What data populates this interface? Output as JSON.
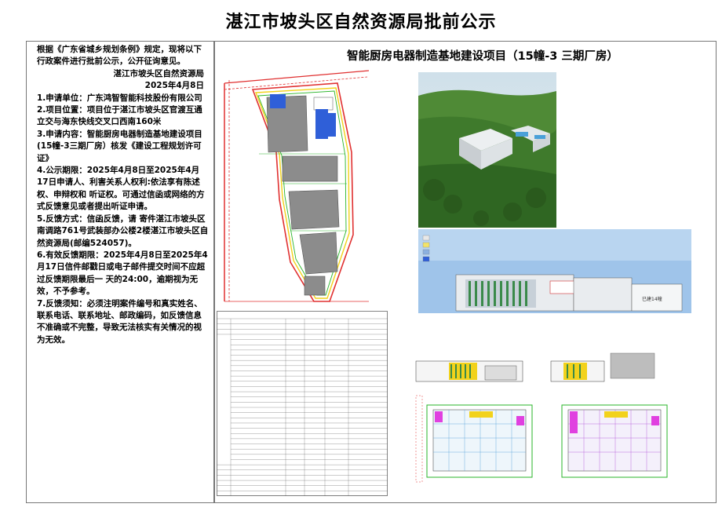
{
  "notice": {
    "title": "湛江市坡头区自然资源局批前公示",
    "intro": "根据《广东省城乡规划条例》规定，现将以下行政案件进行批前公示，公开征询意见。",
    "issuer": "湛江市坡头区自然资源局",
    "date": "2025年4月8日",
    "items": [
      "1.申请单位：广东鸿智智能科技股份有限公司",
      "2.项目位置：项目位于湛江市坡头区官渡互通立交与海东快线交叉口西南160米",
      "3.申请内容：智能厨房电器制造基地建设项目(15幢-3三期厂房）核发《建设工程规划许可证》",
      "4.公示期限：2025年4月8日至2025年4月17日申请人、利害关系人权利:依法享有陈述权、申辩权和 听证权。可通过信函或网络的方式反馈意见或者提出听证申请。",
      "5.反馈方式：信函反馈，请 寄件湛江市坡头区南调路761号武装部办公楼2楼湛江市坡头区自然资源局(邮编524057)。",
      "6.有效反馈期限：2025年4月8日至2025年4月17日信件邮戳日或电子邮件提交时间不应超过反馈期限最后一 天的24:00，逾期视为无效，不予参考。",
      "7.反馈须知：必须注明案件编号和真实姓名、联系电话、联系地址、邮政编码，如反馈信息不准确或不完整，导致无法核实有关情况的视为无效。"
    ]
  },
  "project": {
    "title": "智能厨房电器制造基地建设项目（15幢-3 三期厂房）",
    "elevation_tag": "已建14幢"
  },
  "colors": {
    "site_red": "#e03030",
    "building_grey": "#8c8c8c",
    "building_blue": "#2f5fd8",
    "green_line": "#2ab52a",
    "yellow_line": "#f2d21b",
    "sky": "#d6e6ef",
    "forest": "#3f7a2c",
    "elev_sky": "#9fc4ea"
  }
}
